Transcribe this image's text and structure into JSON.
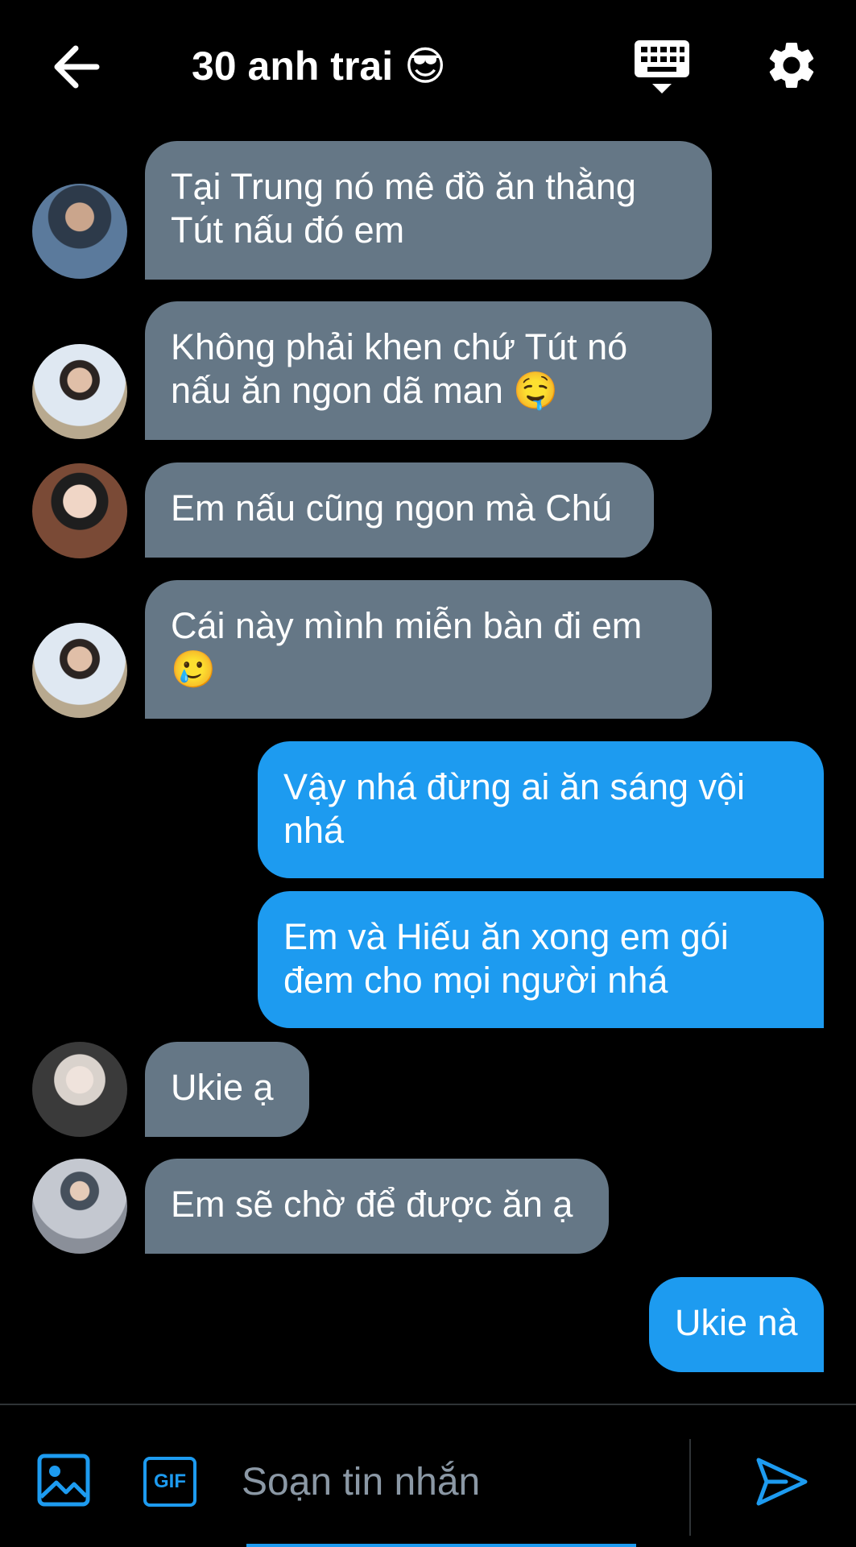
{
  "header": {
    "title": "30 anh trai 😎",
    "icons": [
      "back-arrow-icon",
      "keyboard-icon",
      "gear-icon"
    ]
  },
  "messages": [
    {
      "direction": "incoming",
      "lines": [
        "Tại Trung nó mê đồ ăn thằng",
        "Tút nấu đó em"
      ],
      "avatar": "avatar-1"
    },
    {
      "direction": "incoming",
      "lines": [
        "Không phải khen chứ Tút nó",
        "nấu ăn ngon dã man 🤤"
      ],
      "avatar": "avatar-2"
    },
    {
      "direction": "incoming",
      "lines": [
        "Em nấu cũng ngon mà Chú"
      ],
      "avatar": "avatar-3"
    },
    {
      "direction": "incoming",
      "lines": [
        "Cái này mình miễn bàn đi em",
        "🥲"
      ],
      "avatar": "avatar-2"
    },
    {
      "direction": "outgoing",
      "lines": [
        "Vậy nhá đừng ai ăn sáng vội",
        "nhá"
      ]
    },
    {
      "direction": "outgoing",
      "lines": [
        "Em và Hiếu ăn xong em gói",
        "đem cho mọi người nhá"
      ]
    },
    {
      "direction": "incoming",
      "lines": [
        "Ukie ạ"
      ],
      "avatar": "avatar-4"
    },
    {
      "direction": "incoming",
      "lines": [
        "Em sẽ chờ để được ăn ạ"
      ],
      "avatar": "avatar-5"
    },
    {
      "direction": "outgoing",
      "lines": [
        "Ukie nà"
      ]
    }
  ],
  "composer": {
    "gif_label": "GIF",
    "placeholder": "Soạn tin nhắn",
    "icons": [
      "image-icon",
      "gif-icon",
      "send-icon"
    ]
  },
  "colors": {
    "background": "#000000",
    "incoming_bubble": "#657786",
    "outgoing_bubble": "#1d9bf0",
    "accent": "#1d9bf0"
  }
}
